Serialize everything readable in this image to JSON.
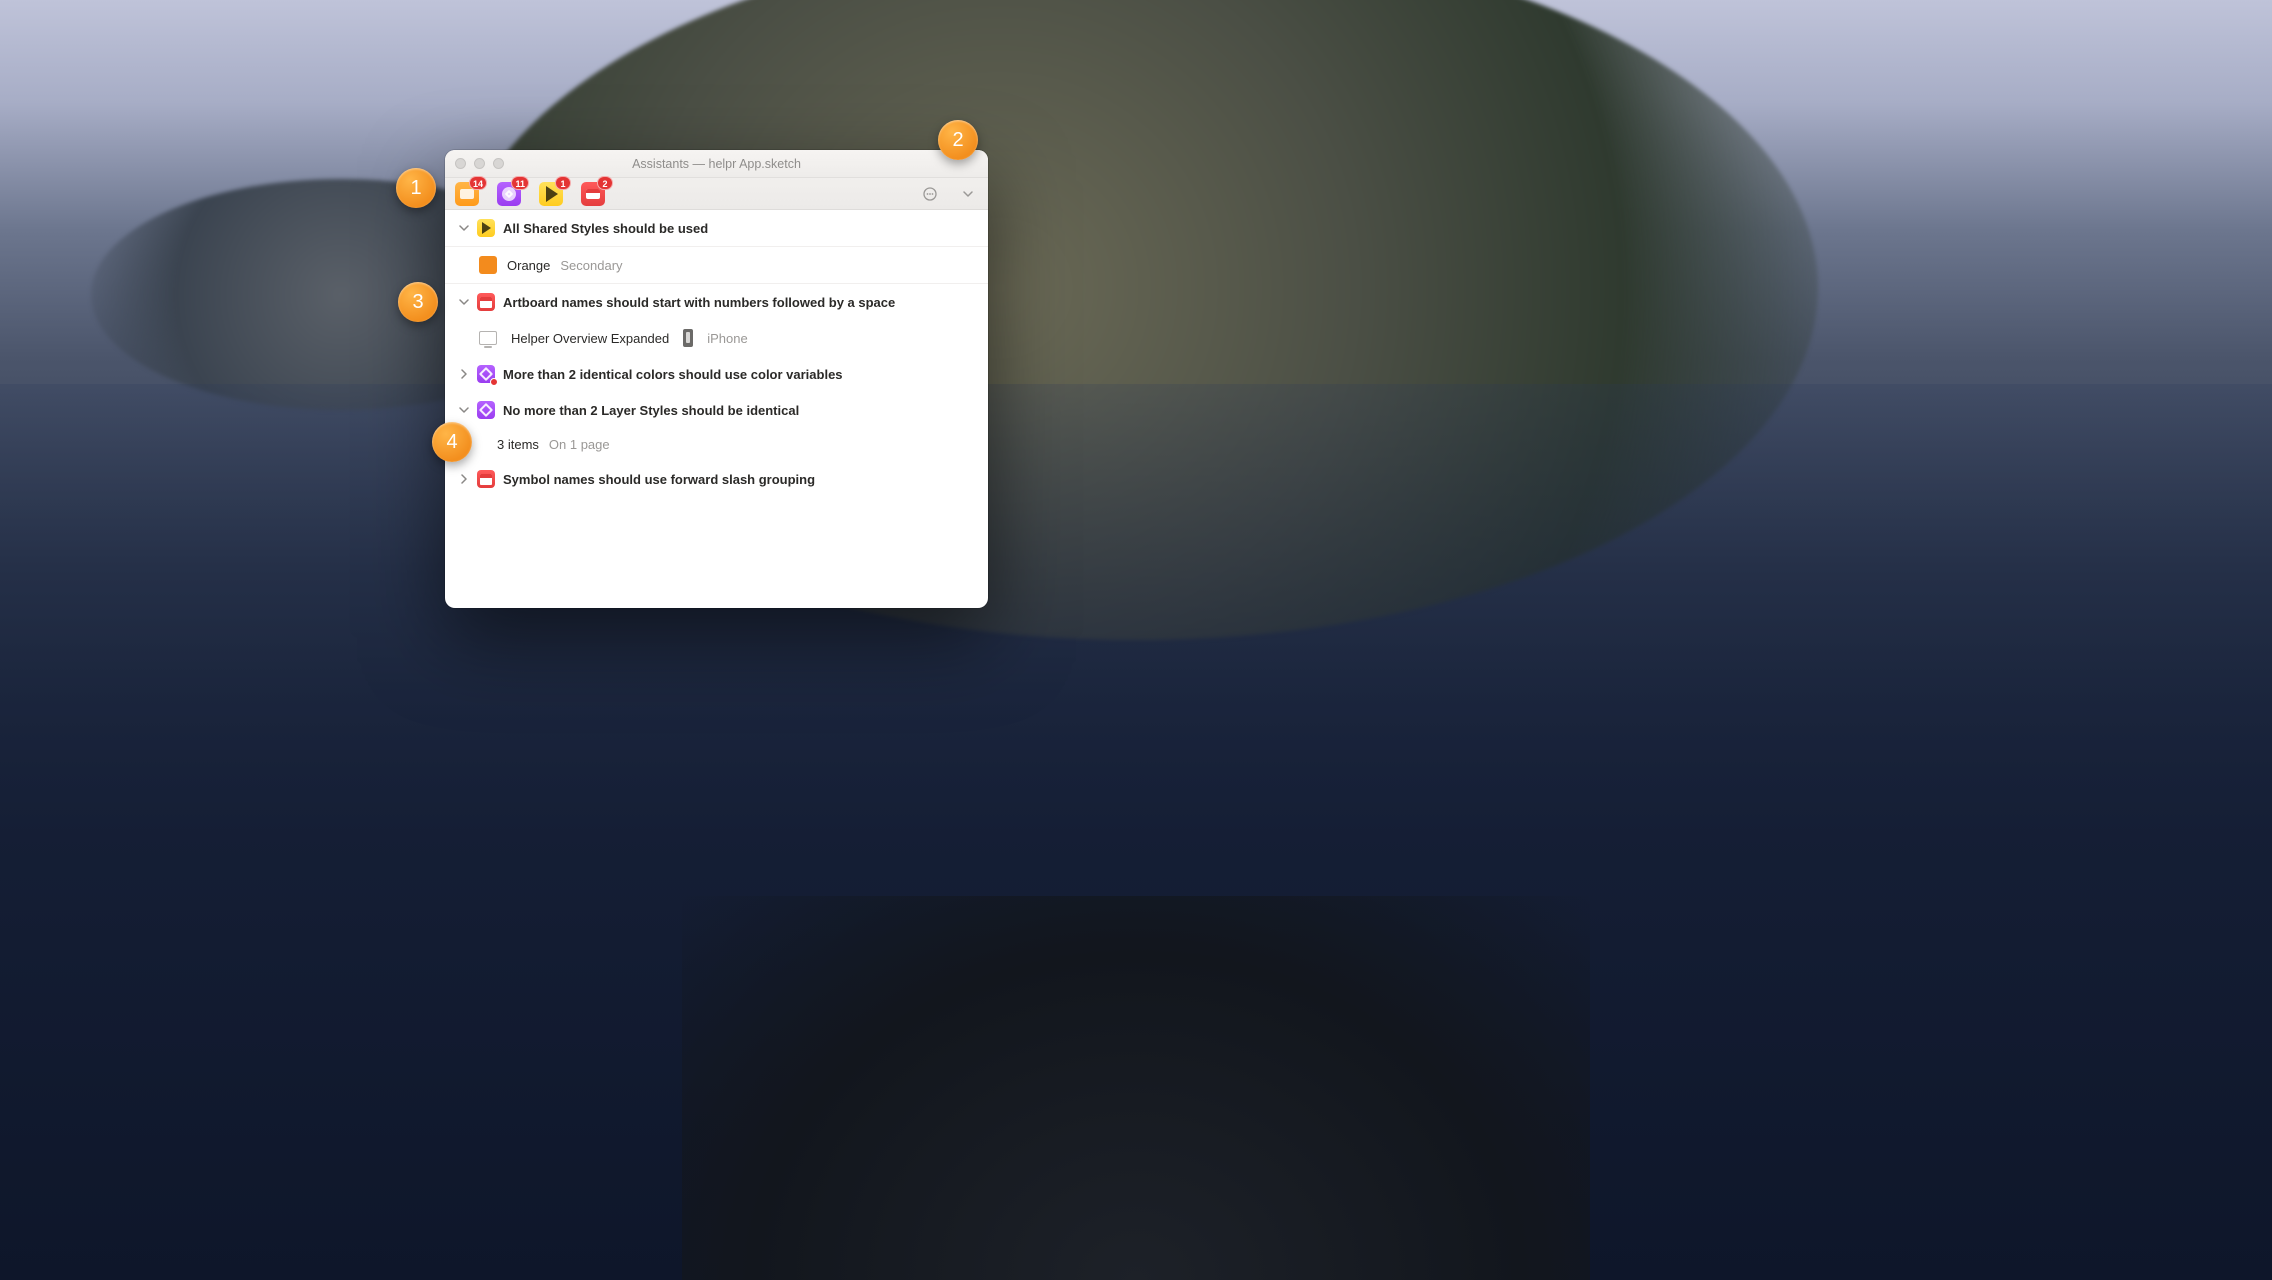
{
  "window": {
    "title": "Assistants — helpr App.sketch"
  },
  "toolbar": {
    "tabs": [
      {
        "color": "orange",
        "badge": "14"
      },
      {
        "color": "purple",
        "badge": "11"
      },
      {
        "color": "yellow",
        "badge": "1"
      },
      {
        "color": "red",
        "badge": "2"
      }
    ]
  },
  "groups": [
    {
      "expanded": true,
      "icon": "yellow",
      "title": "All Shared Styles should be used",
      "children": [
        {
          "type": "swatch",
          "swatch_color": "#f38b1d",
          "label": "Orange",
          "sublabel": "Secondary"
        }
      ]
    },
    {
      "expanded": true,
      "icon": "red",
      "title": "Artboard names should start with numbers followed by a space",
      "children": [
        {
          "type": "artboards",
          "items": [
            {
              "icon": "artboard-icon",
              "label": "Helper Overview Expanded"
            },
            {
              "icon": "phone-icon",
              "label": "iPhone"
            }
          ]
        }
      ]
    },
    {
      "expanded": false,
      "icon": "purple",
      "icon_dot": true,
      "title": "More than 2 identical colors should use color variables"
    },
    {
      "expanded": true,
      "icon": "purple",
      "title": "No more than 2 Layer Styles should be identical",
      "children": [
        {
          "type": "count",
          "label": "3 items",
          "sublabel": "On 1 page"
        }
      ]
    },
    {
      "expanded": false,
      "icon": "red",
      "title": "Symbol names should use forward slash grouping"
    }
  ],
  "annotations": {
    "1": "1",
    "2": "2",
    "3": "3",
    "4": "4"
  }
}
